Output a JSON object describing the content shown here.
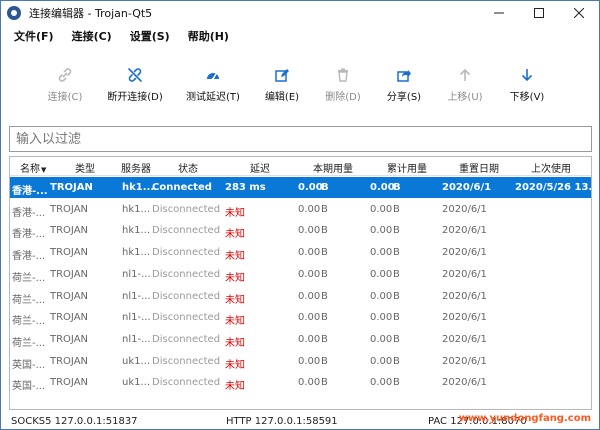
{
  "window": {
    "title": "连接编辑器 - Trojan-Qt5"
  },
  "menu": [
    "文件(F)",
    "连接(C)",
    "设置(S)",
    "帮助(H)"
  ],
  "toolbar": [
    {
      "label": "连接(C)",
      "icon": "link-icon",
      "enabled": false
    },
    {
      "label": "断开连接(D)",
      "icon": "unlink-icon",
      "enabled": true
    },
    {
      "label": "测试延迟(T)",
      "icon": "speedometer-icon",
      "enabled": true
    },
    {
      "label": "编辑(E)",
      "icon": "edit-icon",
      "enabled": true
    },
    {
      "label": "删除(D)",
      "icon": "trash-icon",
      "enabled": false
    },
    {
      "label": "分享(S)",
      "icon": "share-icon",
      "enabled": true
    },
    {
      "label": "上移(U)",
      "icon": "arrow-up-icon",
      "enabled": false
    },
    {
      "label": "下移(V)",
      "icon": "arrow-down-icon",
      "enabled": true
    }
  ],
  "filter": {
    "placeholder": "输入以过滤"
  },
  "table": {
    "columns": [
      "名称",
      "类型",
      "服务器",
      "状态",
      "延迟",
      "本期用量",
      "",
      "累计用量",
      "",
      "重置日期",
      "上次使用"
    ],
    "rows": [
      [
        "香港-...",
        "TROJAN",
        "hk1...",
        "Connected",
        "283 ms",
        "0.00",
        "B",
        "0.00",
        "B",
        "2020/6/1",
        "2020/5/26 13..."
      ],
      [
        "香港-...",
        "TROJAN",
        "hk1...",
        "Disconnected",
        "未知",
        "0.00",
        "B",
        "0.00",
        "B",
        "2020/6/1",
        ""
      ],
      [
        "香港-...",
        "TROJAN",
        "hk1...",
        "Disconnected",
        "未知",
        "0.00",
        "B",
        "0.00",
        "B",
        "2020/6/1",
        ""
      ],
      [
        "香港-...",
        "TROJAN",
        "hk1...",
        "Disconnected",
        "未知",
        "0.00",
        "B",
        "0.00",
        "B",
        "2020/6/1",
        ""
      ],
      [
        "荷兰-...",
        "TROJAN",
        "nl1-...",
        "Disconnected",
        "未知",
        "0.00",
        "B",
        "0.00",
        "B",
        "2020/6/1",
        ""
      ],
      [
        "荷兰-...",
        "TROJAN",
        "nl1-...",
        "Disconnected",
        "未知",
        "0.00",
        "B",
        "0.00",
        "B",
        "2020/6/1",
        ""
      ],
      [
        "荷兰-...",
        "TROJAN",
        "nl1-...",
        "Disconnected",
        "未知",
        "0.00",
        "B",
        "0.00",
        "B",
        "2020/6/1",
        ""
      ],
      [
        "荷兰-...",
        "TROJAN",
        "nl1-...",
        "Disconnected",
        "未知",
        "0.00",
        "B",
        "0.00",
        "B",
        "2020/6/1",
        ""
      ],
      [
        "英国-...",
        "TROJAN",
        "uk1...",
        "Disconnected",
        "未知",
        "0.00",
        "B",
        "0.00",
        "B",
        "2020/6/1",
        ""
      ],
      [
        "英国-...",
        "TROJAN",
        "uk1...",
        "Disconnected",
        "未知",
        "0.00",
        "B",
        "0.00",
        "B",
        "2020/6/1",
        ""
      ]
    ],
    "selected_row": 0
  },
  "status": {
    "socks": "SOCKS5 127.0.0.1:51837",
    "http": "HTTP 127.0.0.1:58591",
    "pac": "PAC 127.0.0.1:8070"
  },
  "watermark": "www.yundongfang.com"
}
